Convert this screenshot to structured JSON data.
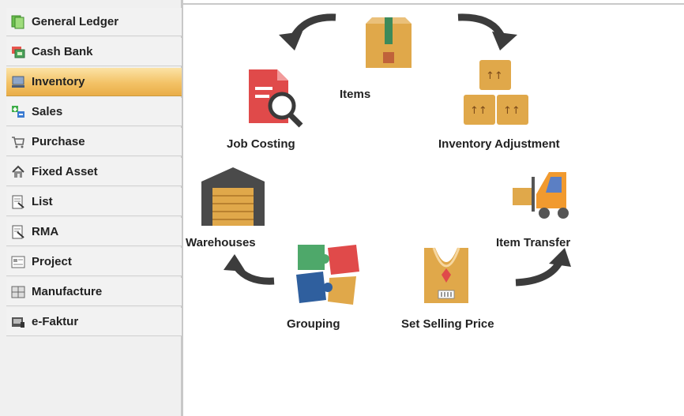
{
  "sidebar": {
    "items": [
      {
        "label": "General Ledger",
        "icon": "ledger-icon"
      },
      {
        "label": "Cash Bank",
        "icon": "cash-bank-icon"
      },
      {
        "label": "Inventory",
        "icon": "inventory-icon",
        "active": true
      },
      {
        "label": "Sales",
        "icon": "sales-icon"
      },
      {
        "label": "Purchase",
        "icon": "cart-icon"
      },
      {
        "label": "Fixed Asset",
        "icon": "house-icon"
      },
      {
        "label": "List",
        "icon": "list-icon"
      },
      {
        "label": "RMA",
        "icon": "rma-icon"
      },
      {
        "label": "Project",
        "icon": "project-icon"
      },
      {
        "label": "Manufacture",
        "icon": "manufacture-icon"
      },
      {
        "label": "e-Faktur",
        "icon": "efaktur-icon"
      }
    ]
  },
  "main": {
    "items_label": "Items",
    "job_costing_label": "Job Costing",
    "inventory_adjustment_label": "Inventory Adjustment",
    "warehouses_label": "Warehouses",
    "item_transfer_label": "Item Transfer",
    "grouping_label": "Grouping",
    "set_selling_price_label": "Set Selling Price"
  },
  "colors": {
    "accent_active": "#f3c266",
    "arrow": "#3c3c3c",
    "box": "#e0a84a",
    "red": "#e04a4a"
  }
}
